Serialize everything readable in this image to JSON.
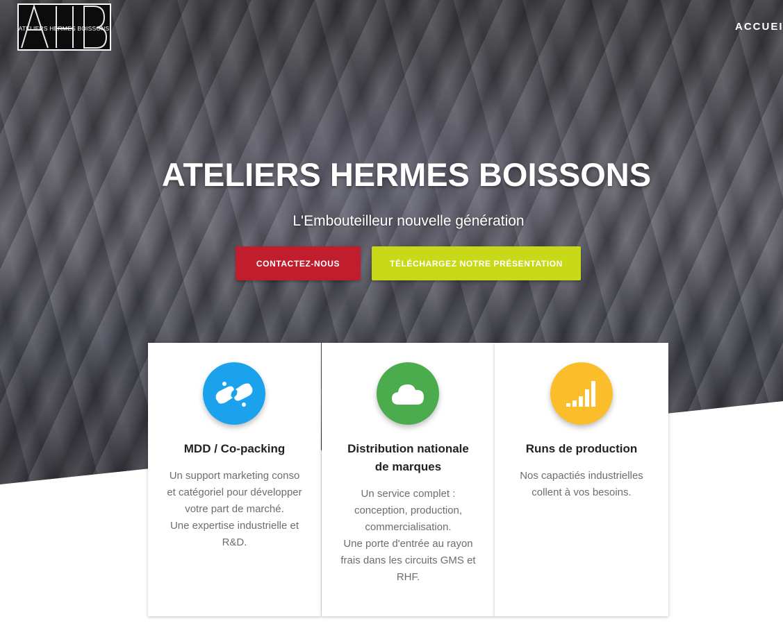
{
  "header": {
    "logo_text": "ATELIERS HERMES BOISSONS",
    "nav": [
      "ACCUEIL"
    ]
  },
  "hero": {
    "title": "ATELIERS HERMES BOISSONS",
    "subtitle": "L'Embouteilleur nouvelle génération",
    "buttons": {
      "contact": "CONTACTEZ-NOUS",
      "download": "TÉLÉCHARGEZ NOTRE PRÉSENTATION"
    }
  },
  "colors": {
    "contact_button": "#c11e2d",
    "download_button": "#c8da17",
    "icon_blue": "#1aa3ec",
    "icon_green": "#4aac4d",
    "icon_yellow": "#fcbd2b"
  },
  "cards": [
    {
      "icon": "handshake-icon",
      "title": "MDD / Co-packing",
      "lines": [
        "Un support marketing conso",
        "et catégoriel pour développer",
        "votre part de marché.",
        "Une expertise industrielle et",
        "R&D."
      ]
    },
    {
      "icon": "cloud-icon",
      "title_lines": [
        "Distribution nationale",
        "de marques"
      ],
      "lines": [
        "Un service complet :",
        "conception, production,",
        "commercialisation.",
        "Une porte d'entrée au rayon",
        "frais dans les circuits GMS et",
        "RHF."
      ]
    },
    {
      "icon": "signal-bars-icon",
      "title": "Runs de production",
      "lines": [
        "Nos capactiés industrielles",
        "collent à vos besoins."
      ]
    }
  ]
}
